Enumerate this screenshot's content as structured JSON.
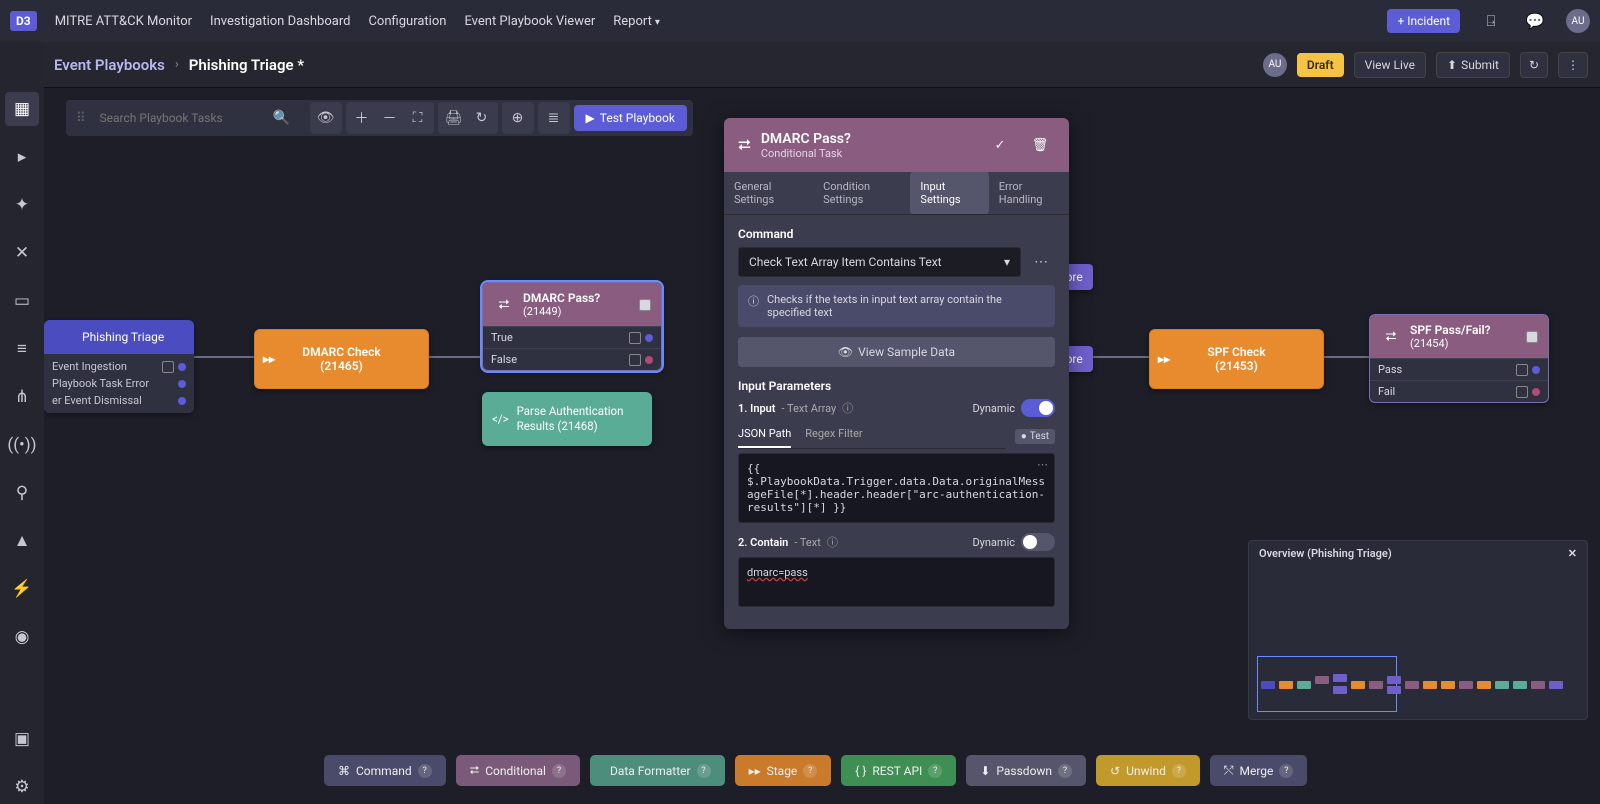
{
  "topnav": {
    "logo": "D3",
    "links": [
      "MITRE ATT&CK Monitor",
      "Investigation Dashboard",
      "Configuration",
      "Event Playbook Viewer",
      "Report"
    ],
    "incident_btn": "+ Incident",
    "avatar": "AU"
  },
  "secondary": {
    "breadcrumb_root": "Event Playbooks",
    "breadcrumb_current": "Phishing Triage *",
    "avatar": "AU",
    "draft": "Draft",
    "view_live": "View Live",
    "submit": "Submit"
  },
  "toolbar": {
    "search_placeholder": "Search Playbook Tasks",
    "test_btn": "Test Playbook"
  },
  "nodes": {
    "trigger": {
      "title": "Phishing Triage",
      "rows": [
        "Event Ingestion",
        "Playbook Task Error",
        "er Event Dismissal"
      ]
    },
    "dmarc_check": {
      "title": "DMARC Check",
      "id": "(21465)"
    },
    "dmarc_pass": {
      "title": "DMARC Pass?",
      "id": "(21449)",
      "rows": [
        "True",
        "False"
      ]
    },
    "parse": {
      "title": "Parse Authentication Results (21468)"
    },
    "risk1": "isk Score",
    "risk2": "isk Score",
    "spf_check": {
      "title": "SPF Check",
      "id": "(21453)"
    },
    "spf_pass": {
      "title": "SPF Pass/Fail?",
      "id": "(21454)",
      "rows": [
        "Pass",
        "Fail"
      ]
    }
  },
  "details": {
    "title": "DMARC Pass?",
    "subtitle": "Conditional Task",
    "tabs": [
      "General Settings",
      "Condition Settings",
      "Input Settings",
      "Error Handling"
    ],
    "active_tab": 2,
    "command_label": "Command",
    "command_value": "Check Text Array Item Contains Text",
    "info": "Checks if the texts in input text array contain the specified text",
    "sample_btn": "View Sample Data",
    "input_params_label": "Input Parameters",
    "params": [
      {
        "num": "1.",
        "name": "Input",
        "type": "- Text Array",
        "dynamic_label": "Dynamic",
        "dynamic": true
      },
      {
        "num": "2.",
        "name": "Contain",
        "type": "- Text",
        "dynamic_label": "Dynamic",
        "dynamic": false
      }
    ],
    "subtabs": [
      "JSON Path",
      "Regex Filter"
    ],
    "test_label": "Test",
    "json_path_value": "{{\n$.PlaybookData.Trigger.data.Data.originalMessageFile[*].header.header[\"arc-authentication-results\"][*] }}",
    "contain_value": "dmarc=pass"
  },
  "overview": {
    "title": "Overview (Phishing Triage)"
  },
  "palette": [
    {
      "label": "Command",
      "color": "#4a4b6a",
      "icon": "⌘"
    },
    {
      "label": "Conditional",
      "color": "#7a5a78",
      "icon": "⮂"
    },
    {
      "label": "Data Formatter",
      "color": "#4d8d7b",
      "icon": "</>"
    },
    {
      "label": "Stage",
      "color": "#c97a2b",
      "icon": "▸▸"
    },
    {
      "label": "REST API",
      "color": "#3f8f54",
      "icon": "{ }"
    },
    {
      "label": "Passdown",
      "color": "#55566c",
      "icon": "⬇"
    },
    {
      "label": "Unwind",
      "color": "#c29a2b",
      "icon": "↺"
    },
    {
      "label": "Merge",
      "color": "#4a4b6a",
      "icon": "⤲"
    }
  ]
}
